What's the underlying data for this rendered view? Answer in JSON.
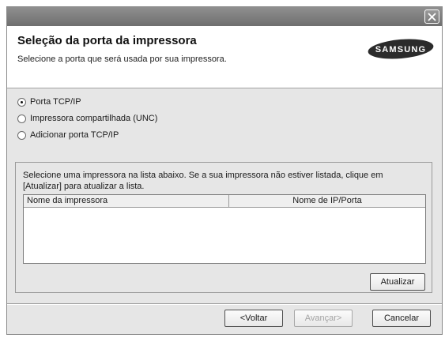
{
  "window": {
    "close_icon": "close-icon"
  },
  "header": {
    "title": "Seleção da porta da impressora",
    "subtitle": "Selecione a porta que será usada por sua impressora.",
    "logo_text": "SAMSUNG"
  },
  "port_options": [
    {
      "label": "Porta TCP/IP",
      "checked": true
    },
    {
      "label": "Impressora compartilhada (UNC)",
      "checked": false
    },
    {
      "label": "Adicionar porta TCP/IP",
      "checked": false
    }
  ],
  "printer_list": {
    "instructions": "Selecione uma impressora na lista abaixo. Se a sua impressora não estiver listada, clique em [Atualizar] para atualizar a lista.",
    "columns": [
      "Nome da impressora",
      "Nome de IP/Porta"
    ],
    "rows": [],
    "refresh_label": "Atualizar"
  },
  "footer": {
    "back_label": "<Voltar",
    "next_label": "Avançar>",
    "cancel_label": "Cancelar"
  }
}
